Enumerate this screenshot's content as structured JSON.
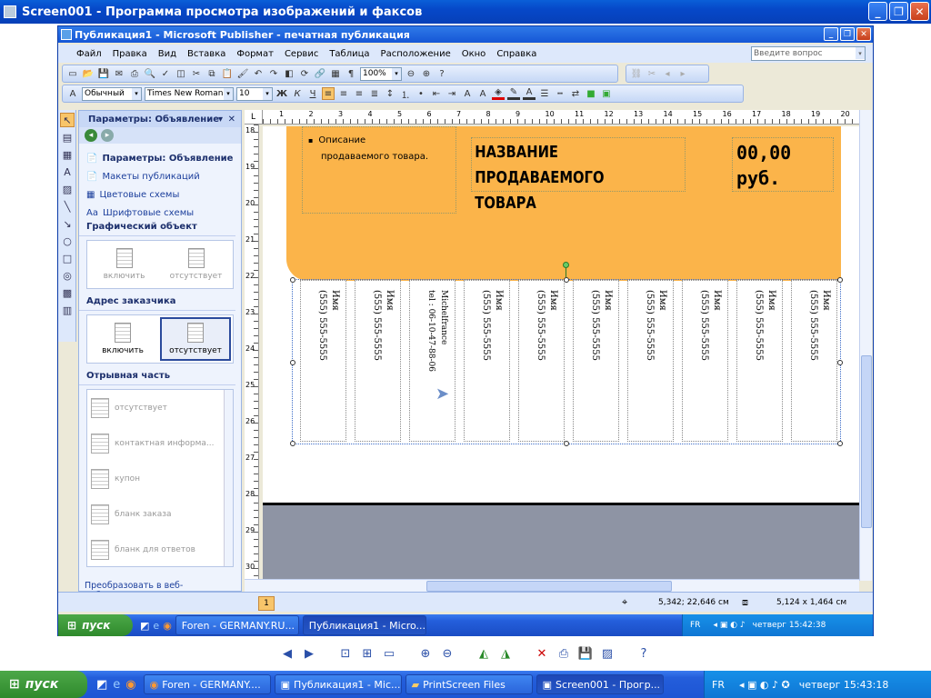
{
  "outer_window": {
    "title": "Screen001 - Программа просмотра изображений и факсов"
  },
  "publisher": {
    "title": "Публикация1 - Microsoft Publisher - печатная публикация",
    "menu": [
      "Файл",
      "Правка",
      "Вид",
      "Вставка",
      "Формат",
      "Сервис",
      "Таблица",
      "Расположение",
      "Окно",
      "Справка"
    ],
    "help_placeholder": "Введите вопрос",
    "zoom": "100%",
    "style_value": "Обычный",
    "font_value": "Times New Roman",
    "size_value": "10"
  },
  "task_pane": {
    "title": "Параметры: Объявление",
    "links": [
      "Параметры: Объявление",
      "Макеты публикаций",
      "Цветовые схемы",
      "Шрифтовые схемы"
    ],
    "section_graphic": "Графический объект",
    "graphic_options": [
      "включить",
      "отсутствует"
    ],
    "section_address": "Адрес заказчика",
    "address_options": [
      "включить",
      "отсутствует"
    ],
    "section_tear": "Отрывная часть",
    "tear_options": [
      "отсутствует",
      "контактная информа...",
      "купон",
      "бланк заказа",
      "бланк для ответов"
    ],
    "convert_link": "Преобразовать в веб-публикацию..."
  },
  "flyer": {
    "bullet_text_line1": "Описание",
    "bullet_text_line2": "продаваемого товара.",
    "product_line1": "НАЗВАНИЕ ПРОДАВАЕМОГО",
    "product_line2": "ТОВАРА",
    "price_line1": "00,00",
    "price_line2": "руб.",
    "strips": [
      {
        "line1": "Имя",
        "line2": "(555) 555-5555"
      },
      {
        "line1": "Имя",
        "line2": "(555) 555-5555"
      },
      {
        "line1": "Michelfrance",
        "line2": "tel : 06-10-47-88-06"
      },
      {
        "line1": "Имя",
        "line2": "(555) 555-5555"
      },
      {
        "line1": "Имя",
        "line2": "(555) 555-5555"
      },
      {
        "line1": "Имя",
        "line2": "(555) 555-5555"
      },
      {
        "line1": "Имя",
        "line2": "(555) 555-5555"
      },
      {
        "line1": "Имя",
        "line2": "(555) 555-5555"
      },
      {
        "line1": "Имя",
        "line2": "(555) 555-5555"
      },
      {
        "line1": "Имя",
        "line2": "(555) 555-5555"
      }
    ]
  },
  "ruler": {
    "top": [
      "1",
      "2",
      "3",
      "4",
      "5",
      "6",
      "7",
      "8",
      "9",
      "10",
      "11",
      "12",
      "13",
      "14",
      "15",
      "16",
      "17",
      "18",
      "19",
      "20"
    ],
    "left": [
      "18",
      "19",
      "20",
      "21",
      "22",
      "23",
      "24",
      "25",
      "26",
      "27",
      "28",
      "29",
      "30"
    ]
  },
  "status": {
    "page": "1",
    "position": "5,342; 22,646 см",
    "size": "5,124 x 1,464 см"
  },
  "inner_taskbar": {
    "start": "пуск",
    "items": [
      "Foren - GERMANY.RU...",
      "Публикация1 - Micro..."
    ],
    "lang": "FR",
    "clock": "четверг 15:42:38"
  },
  "taskbar": {
    "start": "пуск",
    "items": [
      "Foren - GERMANY....",
      "Публикация1 - Mic...",
      "PrintScreen Files",
      "Screen001 - Прогр..."
    ],
    "lang": "FR",
    "clock": "четверг 15:43:18"
  }
}
